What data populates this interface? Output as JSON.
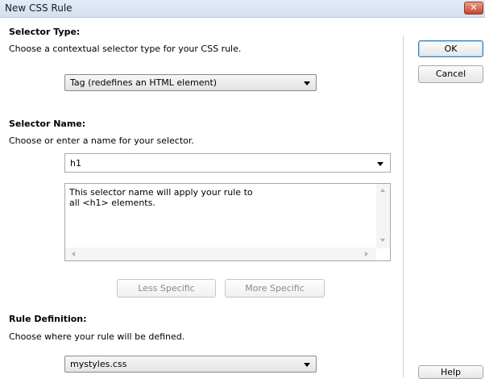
{
  "window": {
    "title": "New CSS Rule",
    "close_label": "✕"
  },
  "selector_type": {
    "heading": "Selector Type:",
    "description": "Choose a contextual selector type for your CSS rule.",
    "selected": "Tag (redefines an HTML element)"
  },
  "selector_name": {
    "heading": "Selector Name:",
    "description": "Choose or enter a name for your selector.",
    "value": "h1",
    "info_line1": "This selector name will apply your rule to",
    "info_line2": "all <h1> elements.",
    "less_specific": "Less Specific",
    "more_specific": "More Specific"
  },
  "rule_definition": {
    "heading": "Rule Definition:",
    "description": "Choose where your rule will be defined.",
    "selected": "mystyles.css"
  },
  "buttons": {
    "ok": "OK",
    "cancel": "Cancel",
    "help": "Help"
  }
}
